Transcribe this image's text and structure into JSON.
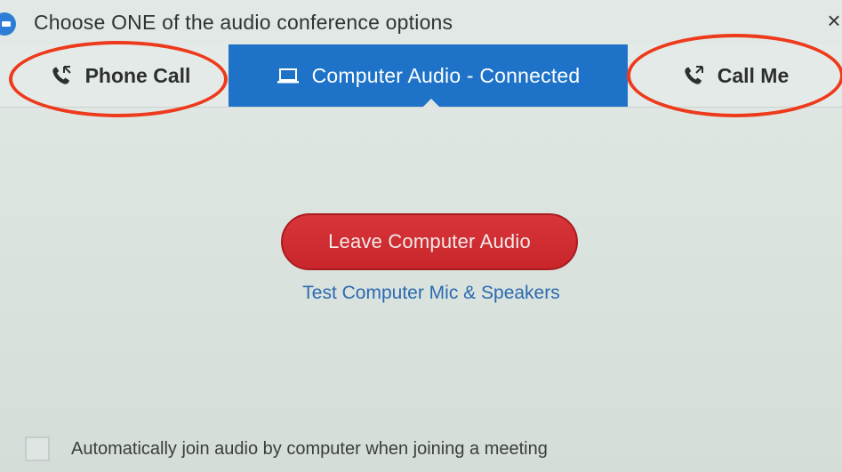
{
  "window": {
    "title": "Choose ONE of the audio conference options",
    "close_glyph": "×"
  },
  "tabs": [
    {
      "label": "Phone Call",
      "icon": "phone-call-icon",
      "active": false
    },
    {
      "label": "Computer Audio - Connected",
      "icon": "laptop-icon",
      "active": true
    },
    {
      "label": "Call Me",
      "icon": "call-me-icon",
      "active": false
    }
  ],
  "main": {
    "leave_button": "Leave Computer Audio",
    "test_link": "Test Computer Mic & Speakers"
  },
  "footer": {
    "auto_join_label": "Automatically join audio by computer when joining a meeting",
    "auto_join_checked": false
  },
  "colors": {
    "active_tab": "#1e73c9",
    "leave_button": "#cf2e33",
    "link": "#2b6ab0",
    "annotation": "#ee3a1c"
  }
}
